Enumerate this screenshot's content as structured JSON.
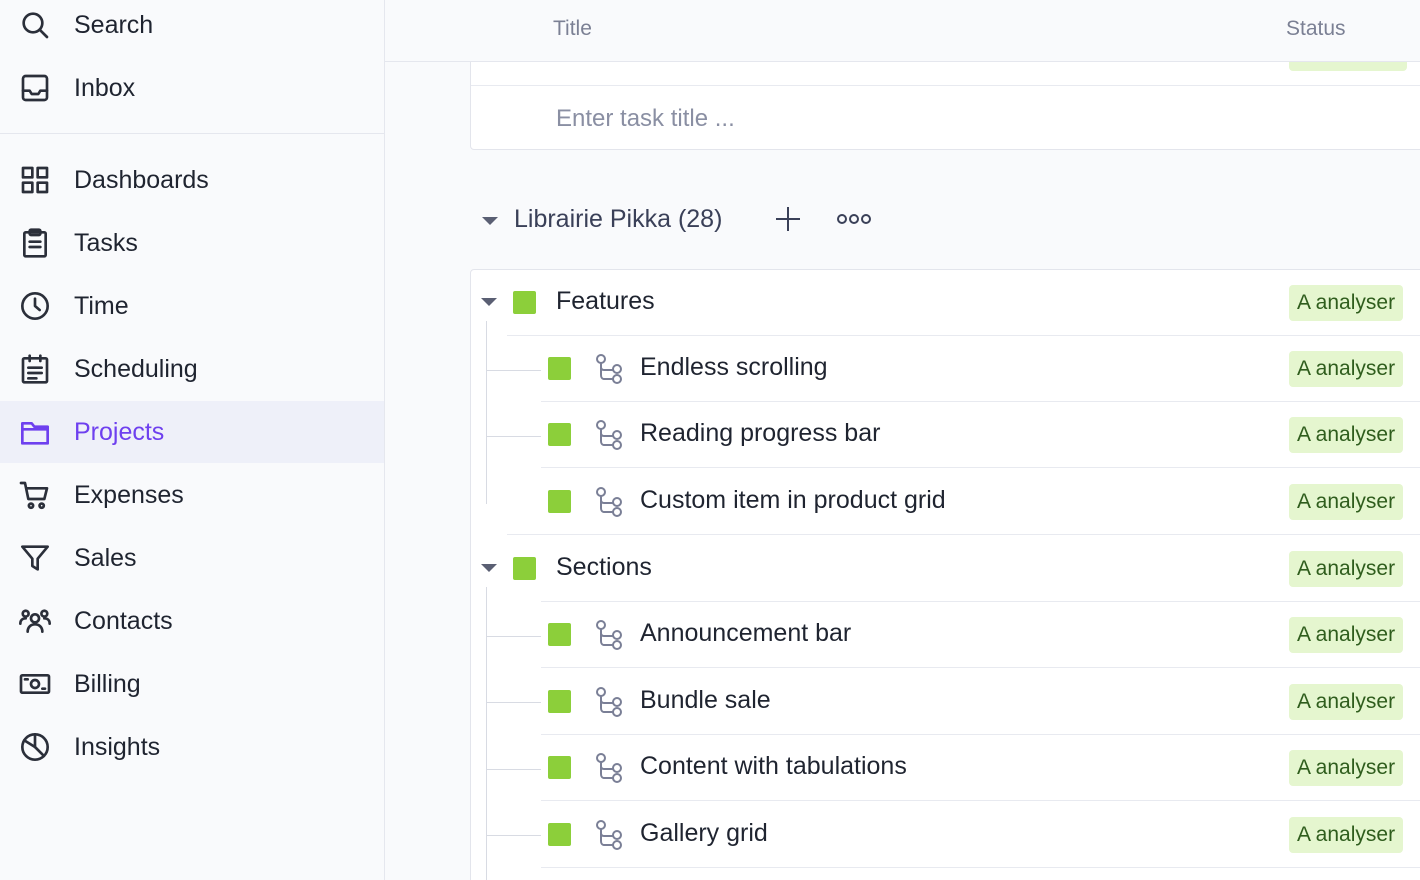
{
  "sidebar": {
    "top_items": [
      {
        "label": "Search",
        "icon": "search-icon"
      },
      {
        "label": "Inbox",
        "icon": "inbox-icon"
      }
    ],
    "items": [
      {
        "label": "Dashboards",
        "icon": "grid-icon"
      },
      {
        "label": "Tasks",
        "icon": "clipboard-icon"
      },
      {
        "label": "Time",
        "icon": "clock-icon"
      },
      {
        "label": "Scheduling",
        "icon": "calendar-icon"
      },
      {
        "label": "Projects",
        "icon": "folder-icon",
        "active": true
      },
      {
        "label": "Expenses",
        "icon": "cart-icon"
      },
      {
        "label": "Sales",
        "icon": "funnel-icon"
      },
      {
        "label": "Contacts",
        "icon": "users-icon"
      },
      {
        "label": "Billing",
        "icon": "banknote-icon"
      },
      {
        "label": "Insights",
        "icon": "pie-chart-icon"
      }
    ],
    "active_color": "#6e40ef"
  },
  "header": {
    "title_col": "Title",
    "status_col": "Status"
  },
  "new_task": {
    "placeholder": "Enter task title ..."
  },
  "group": {
    "title": "Librairie Pikka (28)"
  },
  "rows": [
    {
      "title": "Features",
      "status": "A analyser",
      "level": "parent"
    },
    {
      "title": "Endless scrolling",
      "status": "A analyser",
      "level": "child"
    },
    {
      "title": "Reading progress bar",
      "status": "A analyser",
      "level": "child"
    },
    {
      "title": "Custom item in product grid",
      "status": "A analyser",
      "level": "child"
    },
    {
      "title": "Sections",
      "status": "A analyser",
      "level": "parent"
    },
    {
      "title": "Announcement bar",
      "status": "A analyser",
      "level": "child"
    },
    {
      "title": "Bundle sale",
      "status": "A analyser",
      "level": "child"
    },
    {
      "title": "Content with tabulations",
      "status": "A analyser",
      "level": "child"
    },
    {
      "title": "Gallery grid",
      "status": "A analyser",
      "level": "child"
    }
  ],
  "colors": {
    "status_badge_bg": "#e5f6cf",
    "task_square": "#8ccf3a"
  }
}
